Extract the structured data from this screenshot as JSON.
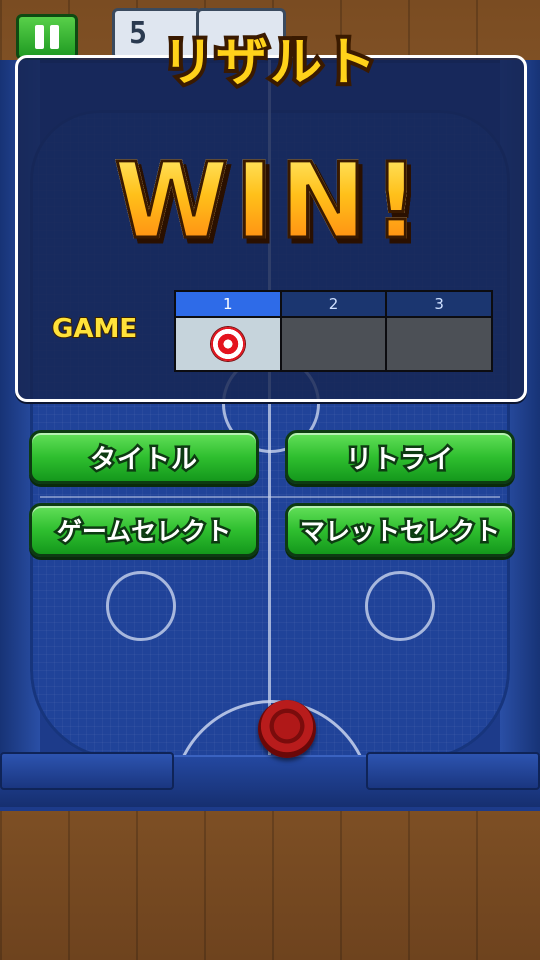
{
  "hud": {
    "pause_icon": "pause-icon",
    "score_left": "5",
    "score_right": ""
  },
  "result": {
    "title": "リザルト",
    "outcome": "WIN!",
    "game_label": "GAME",
    "games": [
      {
        "number": "1",
        "result": "won",
        "icon": "target-icon"
      },
      {
        "number": "2",
        "result": "",
        "icon": ""
      },
      {
        "number": "3",
        "result": "",
        "icon": ""
      }
    ]
  },
  "buttons": {
    "title": "タイトル",
    "retry": "リトライ",
    "game_select": "ゲームセレクト",
    "mallet_select": "マレットセレクト"
  },
  "colors": {
    "button_green": "#2fbf2f",
    "table_blue": "#204399",
    "win_orange": "#ffc01a",
    "active_game": "#2e6be8",
    "puck_red": "#b01818"
  }
}
